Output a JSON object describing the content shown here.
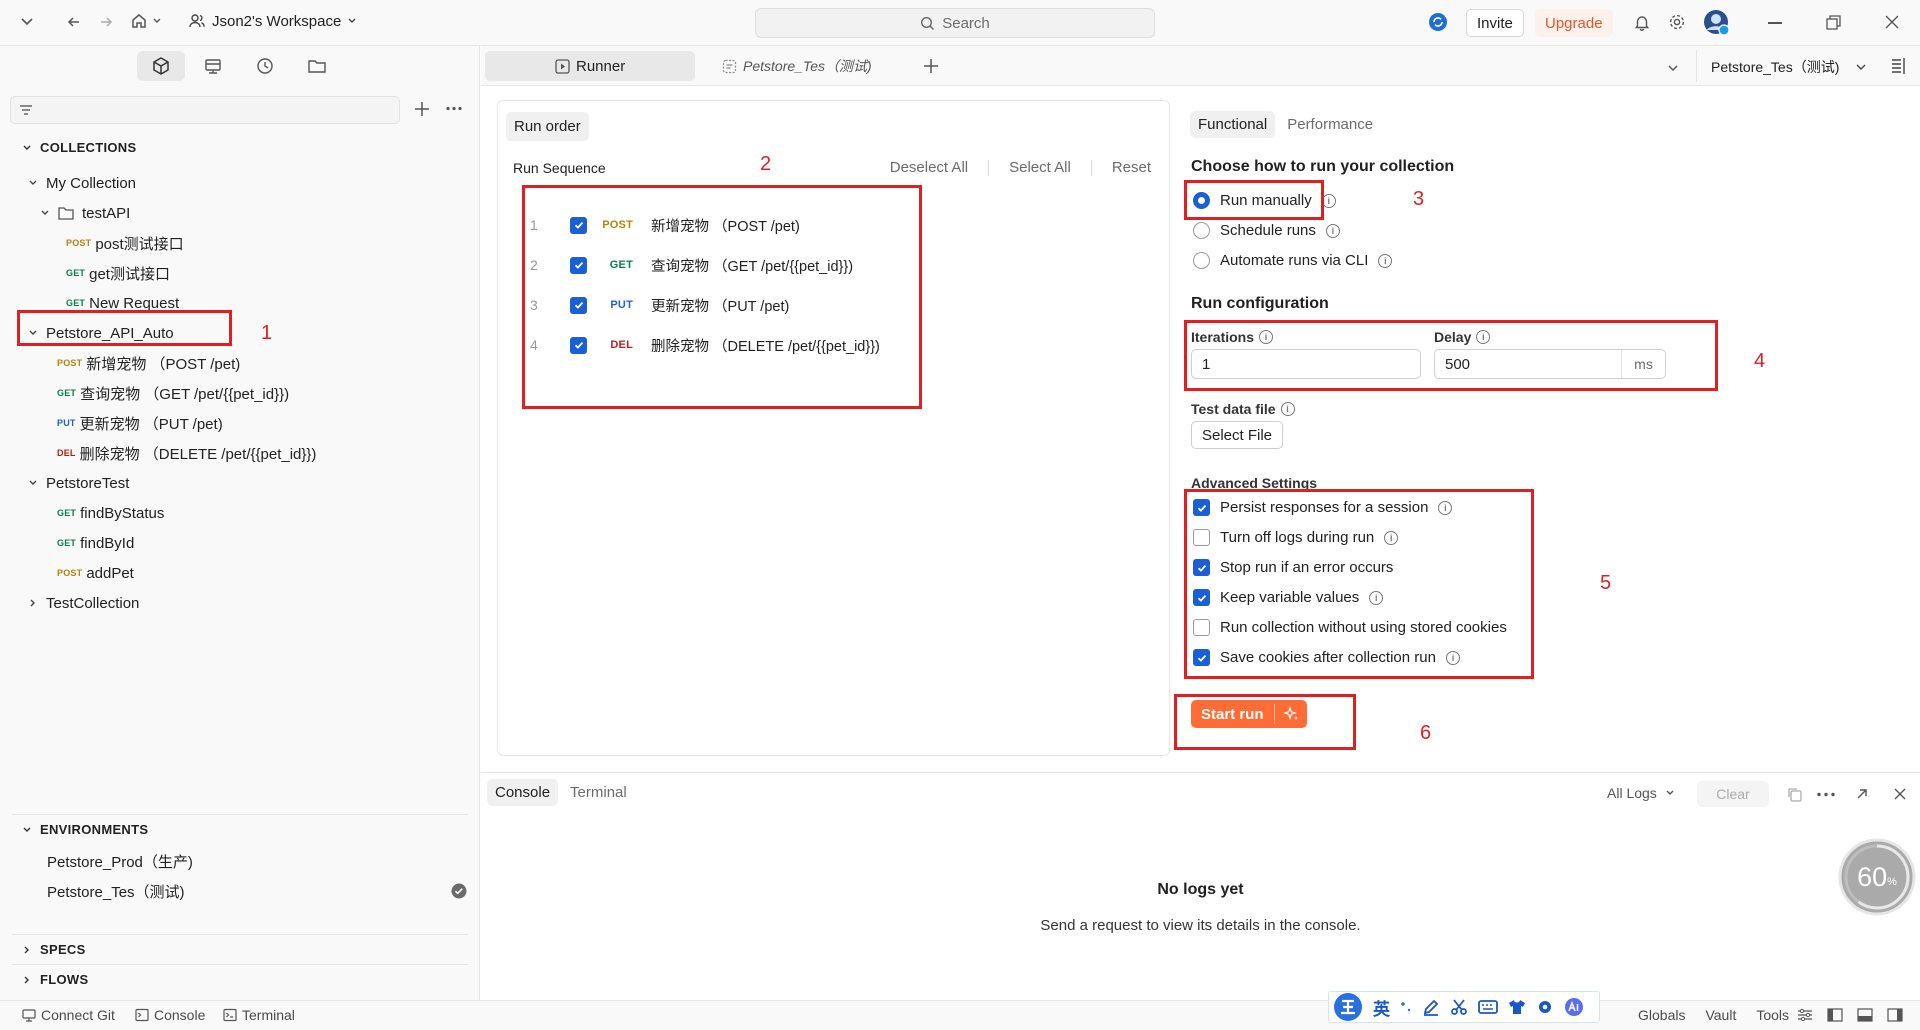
{
  "topbar": {
    "workspace": "Json2's Workspace",
    "search_placeholder": "Search",
    "invite": "Invite",
    "upgrade": "Upgrade"
  },
  "sidebar": {
    "collections_header": "COLLECTIONS",
    "collections": [
      {
        "label": "My Collection",
        "level": 0,
        "kind": "collection",
        "expanded": true
      },
      {
        "label": "testAPI",
        "level": 1,
        "kind": "folder",
        "expanded": true
      },
      {
        "label": "post测试接口",
        "level": 2,
        "kind": "request",
        "method": "POST"
      },
      {
        "label": "get测试接口",
        "level": 2,
        "kind": "request",
        "method": "GET"
      },
      {
        "label": "New Request",
        "level": 2,
        "kind": "request",
        "method": "GET"
      },
      {
        "label": "Petstore_API_Auto",
        "level": 0,
        "kind": "collection",
        "expanded": true
      },
      {
        "label": "新增宠物 （POST /pet)",
        "level": 1,
        "kind": "request",
        "method": "POST"
      },
      {
        "label": "查询宠物 （GET /pet/{{pet_id}})",
        "level": 1,
        "kind": "request",
        "method": "GET"
      },
      {
        "label": "更新宠物 （PUT /pet)",
        "level": 1,
        "kind": "request",
        "method": "PUT"
      },
      {
        "label": "删除宠物 （DELETE /pet/{{pet_id}})",
        "level": 1,
        "kind": "request",
        "method": "DEL"
      },
      {
        "label": "PetstoreTest",
        "level": 0,
        "kind": "collection",
        "expanded": true
      },
      {
        "label": "findByStatus",
        "level": 1,
        "kind": "request",
        "method": "GET"
      },
      {
        "label": "findById",
        "level": 1,
        "kind": "request",
        "method": "GET"
      },
      {
        "label": "addPet",
        "level": 1,
        "kind": "request",
        "method": "POST"
      },
      {
        "label": "TestCollection",
        "level": 0,
        "kind": "collection",
        "expanded": false
      }
    ],
    "environments_header": "ENVIRONMENTS",
    "environments": [
      {
        "label": "Petstore_Prod（生产)",
        "active": false
      },
      {
        "label": "Petstore_Tes（测试)",
        "active": true
      }
    ],
    "specs_header": "SPECS",
    "flows_header": "FLOWS"
  },
  "tabs": {
    "runner": "Runner",
    "env_tab": "Petstore_Tes（测试)",
    "env_selector": "Petstore_Tes（测试)"
  },
  "runorder": {
    "title": "Run order",
    "sequence_label": "Run Sequence",
    "deselect_all": "Deselect All",
    "select_all": "Select All",
    "reset": "Reset",
    "items": [
      {
        "num": "1",
        "method": "POST",
        "label": "新增宠物 （POST /pet)",
        "checked": true
      },
      {
        "num": "2",
        "method": "GET",
        "label": "查询宠物 （GET /pet/{{pet_id}})",
        "checked": true
      },
      {
        "num": "3",
        "method": "PUT",
        "label": "更新宠物 （PUT /pet)",
        "checked": true
      },
      {
        "num": "4",
        "method": "DEL",
        "label": "删除宠物 （DELETE /pet/{{pet_id}})",
        "checked": true
      }
    ]
  },
  "config": {
    "tab_functional": "Functional",
    "tab_performance": "Performance",
    "choose_title": "Choose how to run your collection",
    "run_modes": [
      {
        "label": "Run manually",
        "selected": true
      },
      {
        "label": "Schedule runs",
        "selected": false
      },
      {
        "label": "Automate runs via CLI",
        "selected": false
      }
    ],
    "run_config_title": "Run configuration",
    "iterations_label": "Iterations",
    "iterations_value": "1",
    "delay_label": "Delay",
    "delay_value": "500",
    "delay_unit": "ms",
    "test_data_label": "Test data file",
    "select_file": "Select File",
    "advanced_title": "Advanced Settings",
    "advanced": [
      {
        "label": "Persist responses for a session",
        "checked": true,
        "info": true
      },
      {
        "label": "Turn off logs during run",
        "checked": false,
        "info": true
      },
      {
        "label": "Stop run if an error occurs",
        "checked": true,
        "info": false
      },
      {
        "label": "Keep variable values",
        "checked": true,
        "info": true
      },
      {
        "label": "Run collection without using stored cookies",
        "checked": false,
        "info": false
      },
      {
        "label": "Save cookies after collection run",
        "checked": true,
        "info": true
      }
    ],
    "start_run": "Start run"
  },
  "annotations": [
    "1",
    "2",
    "3",
    "4",
    "5",
    "6"
  ],
  "console": {
    "tab_console": "Console",
    "tab_terminal": "Terminal",
    "all_logs": "All Logs",
    "clear": "Clear",
    "empty_title": "No logs yet",
    "empty_desc": "Send a request to view its details in the console."
  },
  "gauge": {
    "value": "60",
    "unit": "%",
    "progress": 0.6
  },
  "ime": {
    "label": "英"
  },
  "statusbar": {
    "connect_git": "Connect Git",
    "console": "Console",
    "terminal": "Terminal",
    "globals": "Globals",
    "vault": "Vault",
    "tools": "Tools"
  },
  "colors": {
    "accent": "#ff6c37",
    "checkbox": "#1a5fd6",
    "annotation": "#e02020"
  }
}
